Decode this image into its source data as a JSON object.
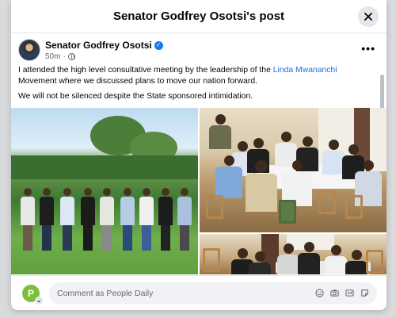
{
  "modal": {
    "title": "Senator Godfrey Osotsi's post",
    "close_icon": "close-icon"
  },
  "post": {
    "author": "Senator Godfrey Osotsi",
    "verified_icon": "verified-badge-icon",
    "time": "50m",
    "audience_icon": "globe-icon",
    "more_icon": "more-options-icon",
    "text": {
      "p1_before": "I attended the high level consultative meeting by the leadership of the ",
      "p1_link": "Linda Mwananchi",
      "p1_after": " Movement where we discussed plans to move our nation forward.",
      "p2": "We will not be silenced despite the State sponsored intimidation."
    },
    "photos": [
      "group-photo-outdoors",
      "meeting-room-photo",
      "meeting-table-photo"
    ]
  },
  "composer": {
    "avatar_letter": "P",
    "placeholder": "Comment as People Daily",
    "tools": [
      "emoji-icon",
      "camera-icon",
      "gif-icon",
      "sticker-icon"
    ]
  },
  "colors": {
    "link": "#216fdb",
    "verified": "#1877f2",
    "page_avatar": "#7cbf3a"
  }
}
